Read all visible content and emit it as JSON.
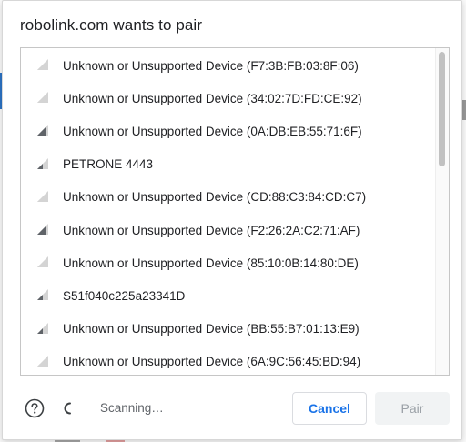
{
  "dialog": {
    "title": "robolink.com wants to pair"
  },
  "devices": [
    {
      "label": "Unknown or Unsupported Device (F7:3B:FB:03:8F:06)",
      "signal": 1,
      "icon": "signal-strength-icon"
    },
    {
      "label": "Unknown or Unsupported Device (34:02:7D:FD:CE:92)",
      "signal": 1,
      "icon": "signal-strength-icon"
    },
    {
      "label": "Unknown or Unsupported Device (0A:DB:EB:55:71:6F)",
      "signal": 3,
      "icon": "signal-strength-icon"
    },
    {
      "label": "PETRONE 4443",
      "signal": 2,
      "icon": "signal-strength-icon"
    },
    {
      "label": "Unknown or Unsupported Device (CD:88:C3:84:CD:C7)",
      "signal": 1,
      "icon": "signal-strength-icon"
    },
    {
      "label": "Unknown or Unsupported Device (F2:26:2A:C2:71:AF)",
      "signal": 3,
      "icon": "signal-strength-icon"
    },
    {
      "label": "Unknown or Unsupported Device (85:10:0B:14:80:DE)",
      "signal": 1,
      "icon": "signal-strength-icon"
    },
    {
      "label": "S51f040c225a23341D",
      "signal": 2,
      "icon": "signal-strength-icon"
    },
    {
      "label": "Unknown or Unsupported Device (BB:55:B7:01:13:E9)",
      "signal": 2,
      "icon": "signal-strength-icon"
    },
    {
      "label": "Unknown or Unsupported Device (6A:9C:56:45:BD:94)",
      "signal": 1,
      "icon": "signal-strength-icon"
    }
  ],
  "footer": {
    "help_icon": "help-circle-icon",
    "spinner_icon": "spinner-icon",
    "status": "Scanning…",
    "cancel_label": "Cancel",
    "pair_label": "Pair"
  },
  "colors": {
    "accent": "#1a73e8",
    "signal_active": "#5f6368",
    "signal_inactive": "#d4d4d4",
    "pair_disabled_bg": "#f1f3f4",
    "pair_disabled_text": "#9aa0a6"
  }
}
